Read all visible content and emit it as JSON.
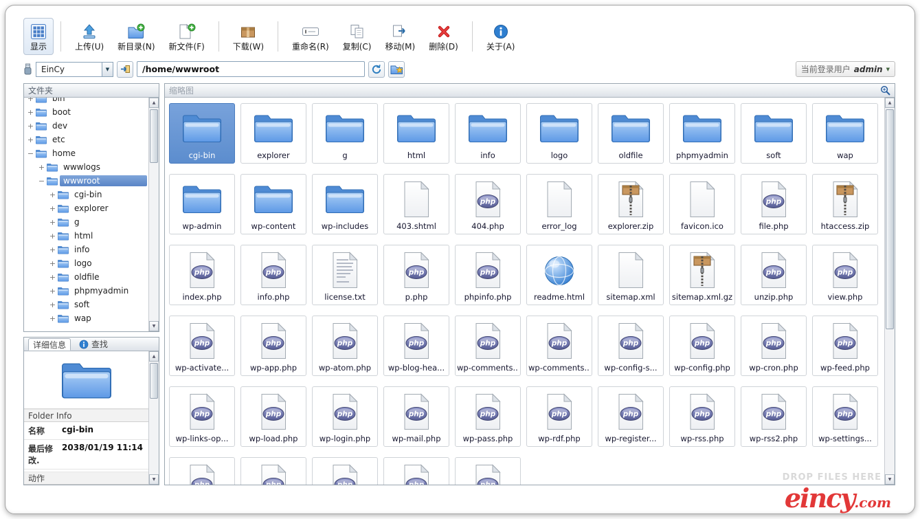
{
  "toolbar": {
    "buttons": [
      {
        "id": "display",
        "label": "显示",
        "icon": "grid-icon",
        "active": true,
        "sep_after": true
      },
      {
        "id": "upload",
        "label": "上传(U)",
        "icon": "upload-icon"
      },
      {
        "id": "new-folder",
        "label": "新目录(N)",
        "icon": "new-folder-icon"
      },
      {
        "id": "new-file",
        "label": "新文件(F)",
        "icon": "new-file-icon",
        "sep_after": true
      },
      {
        "id": "download",
        "label": "下载(W)",
        "icon": "download-icon",
        "sep_after": true
      },
      {
        "id": "rename",
        "label": "重命名(R)",
        "icon": "rename-icon"
      },
      {
        "id": "copy",
        "label": "复制(C)",
        "icon": "copy-icon"
      },
      {
        "id": "move",
        "label": "移动(M)",
        "icon": "move-icon"
      },
      {
        "id": "delete",
        "label": "删除(D)",
        "icon": "delete-icon",
        "sep_after": true
      },
      {
        "id": "about",
        "label": "关于(A)",
        "icon": "about-icon"
      }
    ]
  },
  "addressbar": {
    "site": "EinCy",
    "path": "/home/wwwroot",
    "user_label": "当前登录用户",
    "user_name": "admin"
  },
  "sidebar": {
    "folders_header": "文件夹",
    "tree": [
      {
        "label": "bin",
        "depth": 0,
        "toggle": "+"
      },
      {
        "label": "boot",
        "depth": 0,
        "toggle": "+"
      },
      {
        "label": "dev",
        "depth": 0,
        "toggle": "+"
      },
      {
        "label": "etc",
        "depth": 0,
        "toggle": "+"
      },
      {
        "label": "home",
        "depth": 0,
        "toggle": "-"
      },
      {
        "label": "wwwlogs",
        "depth": 1,
        "toggle": "+"
      },
      {
        "label": "wwwroot",
        "depth": 1,
        "toggle": "-",
        "selected": true
      },
      {
        "label": "cgi-bin",
        "depth": 2,
        "toggle": "+"
      },
      {
        "label": "explorer",
        "depth": 2,
        "toggle": "+"
      },
      {
        "label": "g",
        "depth": 2,
        "toggle": "+"
      },
      {
        "label": "html",
        "depth": 2,
        "toggle": "+"
      },
      {
        "label": "info",
        "depth": 2,
        "toggle": "+"
      },
      {
        "label": "logo",
        "depth": 2,
        "toggle": "+"
      },
      {
        "label": "oldfile",
        "depth": 2,
        "toggle": "+"
      },
      {
        "label": "phpmyadmin",
        "depth": 2,
        "toggle": "+"
      },
      {
        "label": "soft",
        "depth": 2,
        "toggle": "+"
      },
      {
        "label": "wap",
        "depth": 2,
        "toggle": "+"
      }
    ],
    "details": {
      "tab_details": "详细信息",
      "tab_search": "查找",
      "section_info": "Folder Info",
      "rows": [
        {
          "label": "名称",
          "value": "cgi-bin"
        },
        {
          "label": "最后修改.",
          "value": "2038/01/19 11:14"
        }
      ],
      "section_actions": "动作"
    }
  },
  "main": {
    "header": "缩略图",
    "drop_hint": "DROP FILES HERE",
    "items": [
      {
        "label": "cgi-bin",
        "type": "folder",
        "selected": true
      },
      {
        "label": "explorer",
        "type": "folder"
      },
      {
        "label": "g",
        "type": "folder"
      },
      {
        "label": "html",
        "type": "folder"
      },
      {
        "label": "info",
        "type": "folder"
      },
      {
        "label": "logo",
        "type": "folder"
      },
      {
        "label": "oldfile",
        "type": "folder"
      },
      {
        "label": "phpmyadmin",
        "type": "folder"
      },
      {
        "label": "soft",
        "type": "folder"
      },
      {
        "label": "wap",
        "type": "folder"
      },
      {
        "label": "wp-admin",
        "type": "folder"
      },
      {
        "label": "wp-content",
        "type": "folder"
      },
      {
        "label": "wp-includes",
        "type": "folder"
      },
      {
        "label": "403.shtml",
        "type": "file"
      },
      {
        "label": "404.php",
        "type": "php"
      },
      {
        "label": "error_log",
        "type": "file"
      },
      {
        "label": "explorer.zip",
        "type": "zip"
      },
      {
        "label": "favicon.ico",
        "type": "file"
      },
      {
        "label": "file.php",
        "type": "php"
      },
      {
        "label": "htaccess.zip",
        "type": "zip"
      },
      {
        "label": "index.php",
        "type": "php"
      },
      {
        "label": "info.php",
        "type": "php"
      },
      {
        "label": "license.txt",
        "type": "txt"
      },
      {
        "label": "p.php",
        "type": "php"
      },
      {
        "label": "phpinfo.php",
        "type": "php"
      },
      {
        "label": "readme.html",
        "type": "html"
      },
      {
        "label": "sitemap.xml",
        "type": "file"
      },
      {
        "label": "sitemap.xml.gz",
        "type": "zip"
      },
      {
        "label": "unzip.php",
        "type": "php"
      },
      {
        "label": "view.php",
        "type": "php"
      },
      {
        "label": "wp-activate...",
        "type": "php"
      },
      {
        "label": "wp-app.php",
        "type": "php"
      },
      {
        "label": "wp-atom.php",
        "type": "php"
      },
      {
        "label": "wp-blog-hea...",
        "type": "php"
      },
      {
        "label": "wp-comments...",
        "type": "php"
      },
      {
        "label": "wp-comments...",
        "type": "php"
      },
      {
        "label": "wp-config-s...",
        "type": "php"
      },
      {
        "label": "wp-config.php",
        "type": "php"
      },
      {
        "label": "wp-cron.php",
        "type": "php"
      },
      {
        "label": "wp-feed.php",
        "type": "php"
      },
      {
        "label": "wp-links-op...",
        "type": "php"
      },
      {
        "label": "wp-load.php",
        "type": "php"
      },
      {
        "label": "wp-login.php",
        "type": "php"
      },
      {
        "label": "wp-mail.php",
        "type": "php"
      },
      {
        "label": "wp-pass.php",
        "type": "php"
      },
      {
        "label": "wp-rdf.php",
        "type": "php"
      },
      {
        "label": "wp-register...",
        "type": "php"
      },
      {
        "label": "wp-rss.php",
        "type": "php"
      },
      {
        "label": "wp-rss2.php",
        "type": "php"
      },
      {
        "label": "wp-settings...",
        "type": "php"
      },
      {
        "label": "",
        "type": "php"
      },
      {
        "label": "",
        "type": "php"
      },
      {
        "label": "",
        "type": "php"
      },
      {
        "label": "",
        "type": "php"
      },
      {
        "label": "",
        "type": "php"
      }
    ]
  },
  "watermark": {
    "brand": "eincy",
    "suffix": ".com"
  }
}
